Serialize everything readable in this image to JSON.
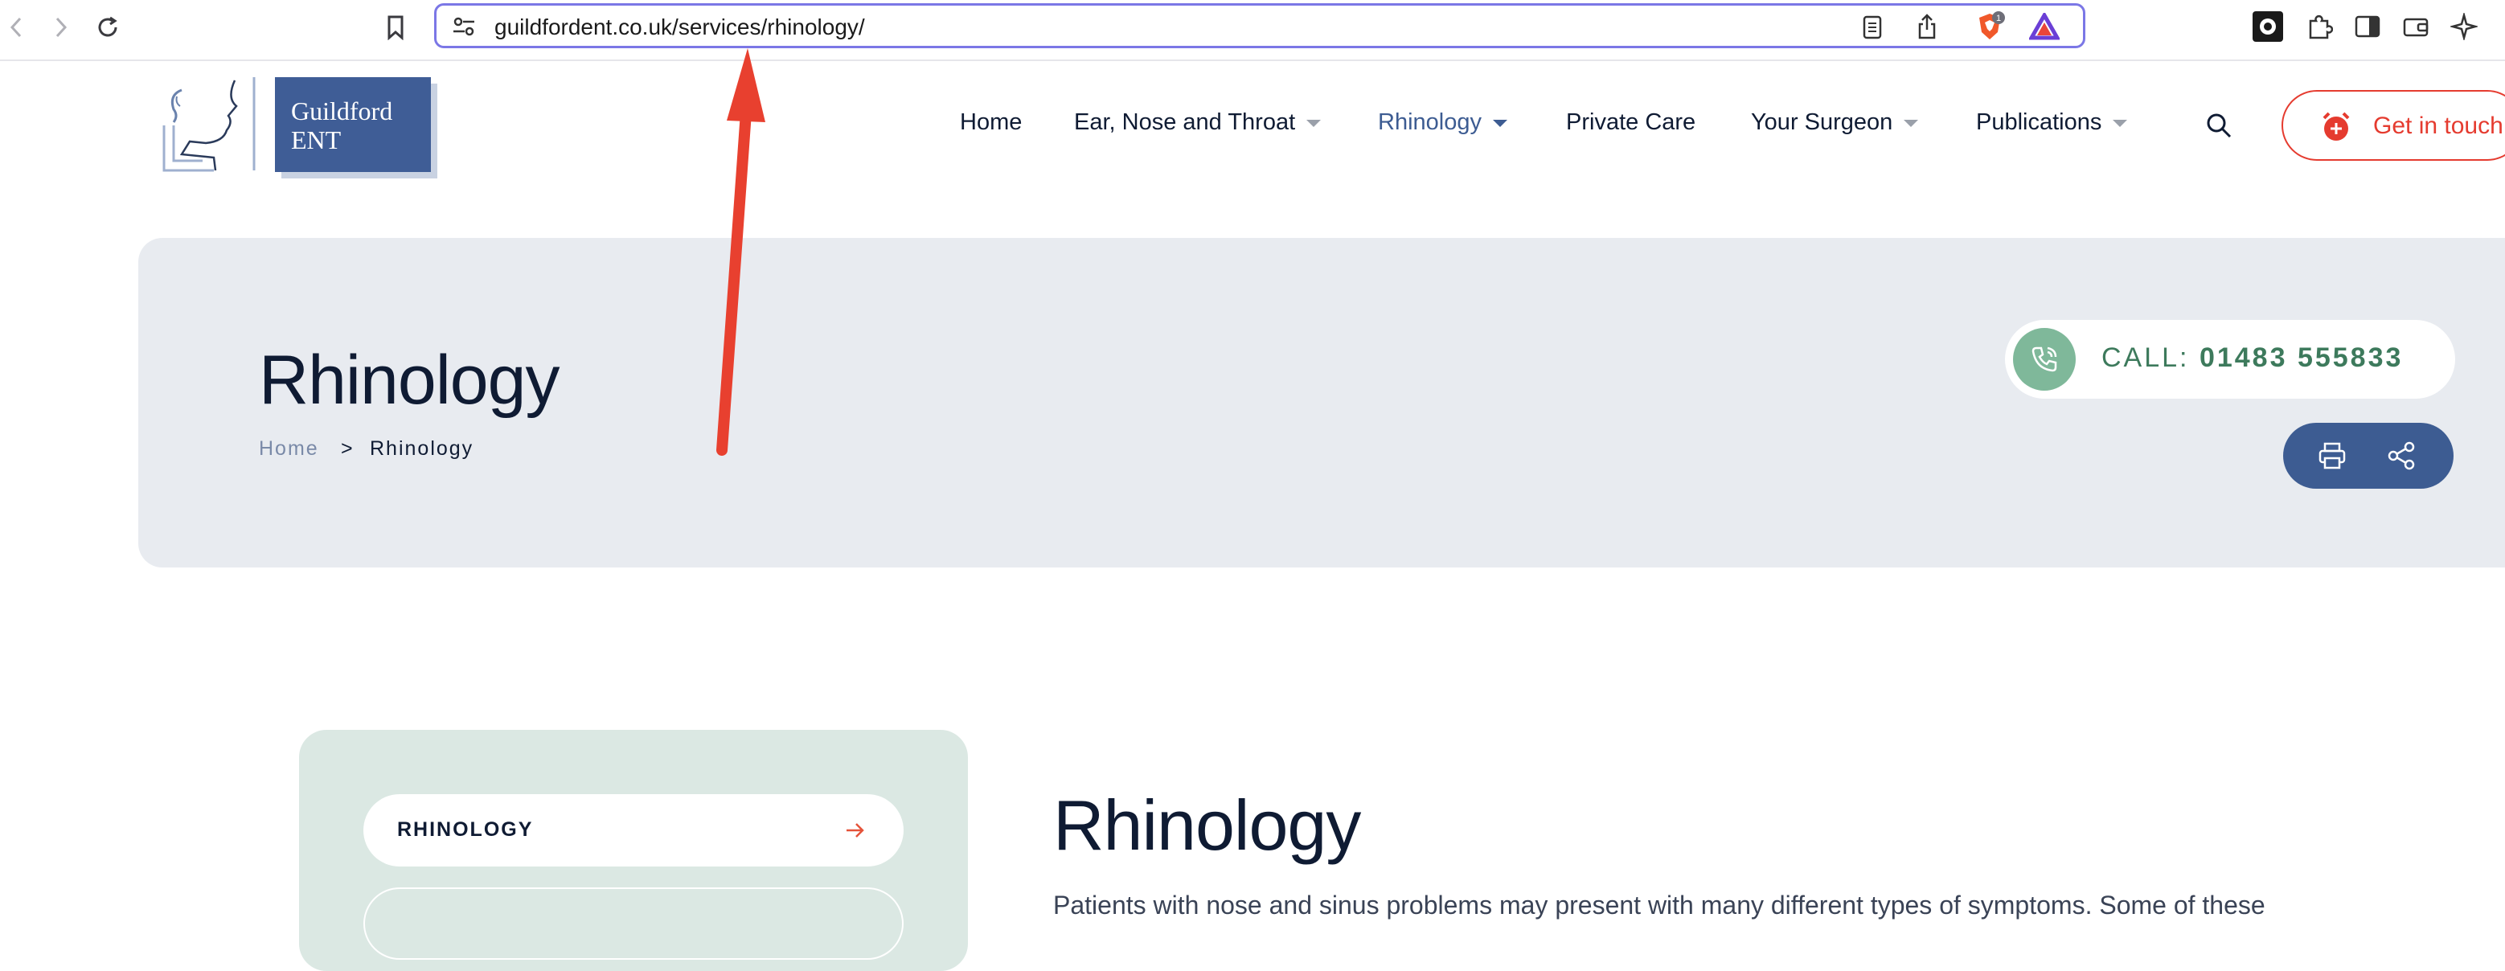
{
  "browser": {
    "url": "guildfordent.co.uk/services/rhinology/",
    "brave_badge_count": "1"
  },
  "site": {
    "logo_line1": "Guildford",
    "logo_line2": "ENT",
    "nav": {
      "home": "Home",
      "ent": "Ear, Nose and Throat",
      "rhinology": "Rhinology",
      "private_care": "Private Care",
      "surgeon": "Your Surgeon",
      "publications": "Publications"
    },
    "cta_label": "Get in touch"
  },
  "hero": {
    "title": "Rhinology",
    "breadcrumb_home": "Home",
    "breadcrumb_sep": ">",
    "breadcrumb_current": "Rhinology",
    "call_label": "CALL: ",
    "call_number": "01483 555833"
  },
  "content": {
    "sidebar_item": "RHINOLOGY",
    "title": "Rhinology",
    "paragraph": "Patients with nose and sinus problems may present with many different types of symptoms. Some of these"
  },
  "colors": {
    "accent": "#3d5c92",
    "cta_red": "#e53b2f",
    "call_green": "#3d7a5c",
    "annotation": "#e8402f"
  },
  "icons": [
    "back-icon",
    "forward-icon",
    "reload-icon",
    "bookmark-icon",
    "site-settings-icon",
    "reader-icon",
    "share-icon",
    "brave-shield-icon",
    "triangle-icon",
    "extension-icon",
    "puzzle-icon",
    "sidebar-icon",
    "wallet-icon",
    "sparkle-icon",
    "search-icon",
    "alarm-icon",
    "phone-icon",
    "print-icon",
    "share-nodes-icon",
    "arrow-right-icon"
  ]
}
